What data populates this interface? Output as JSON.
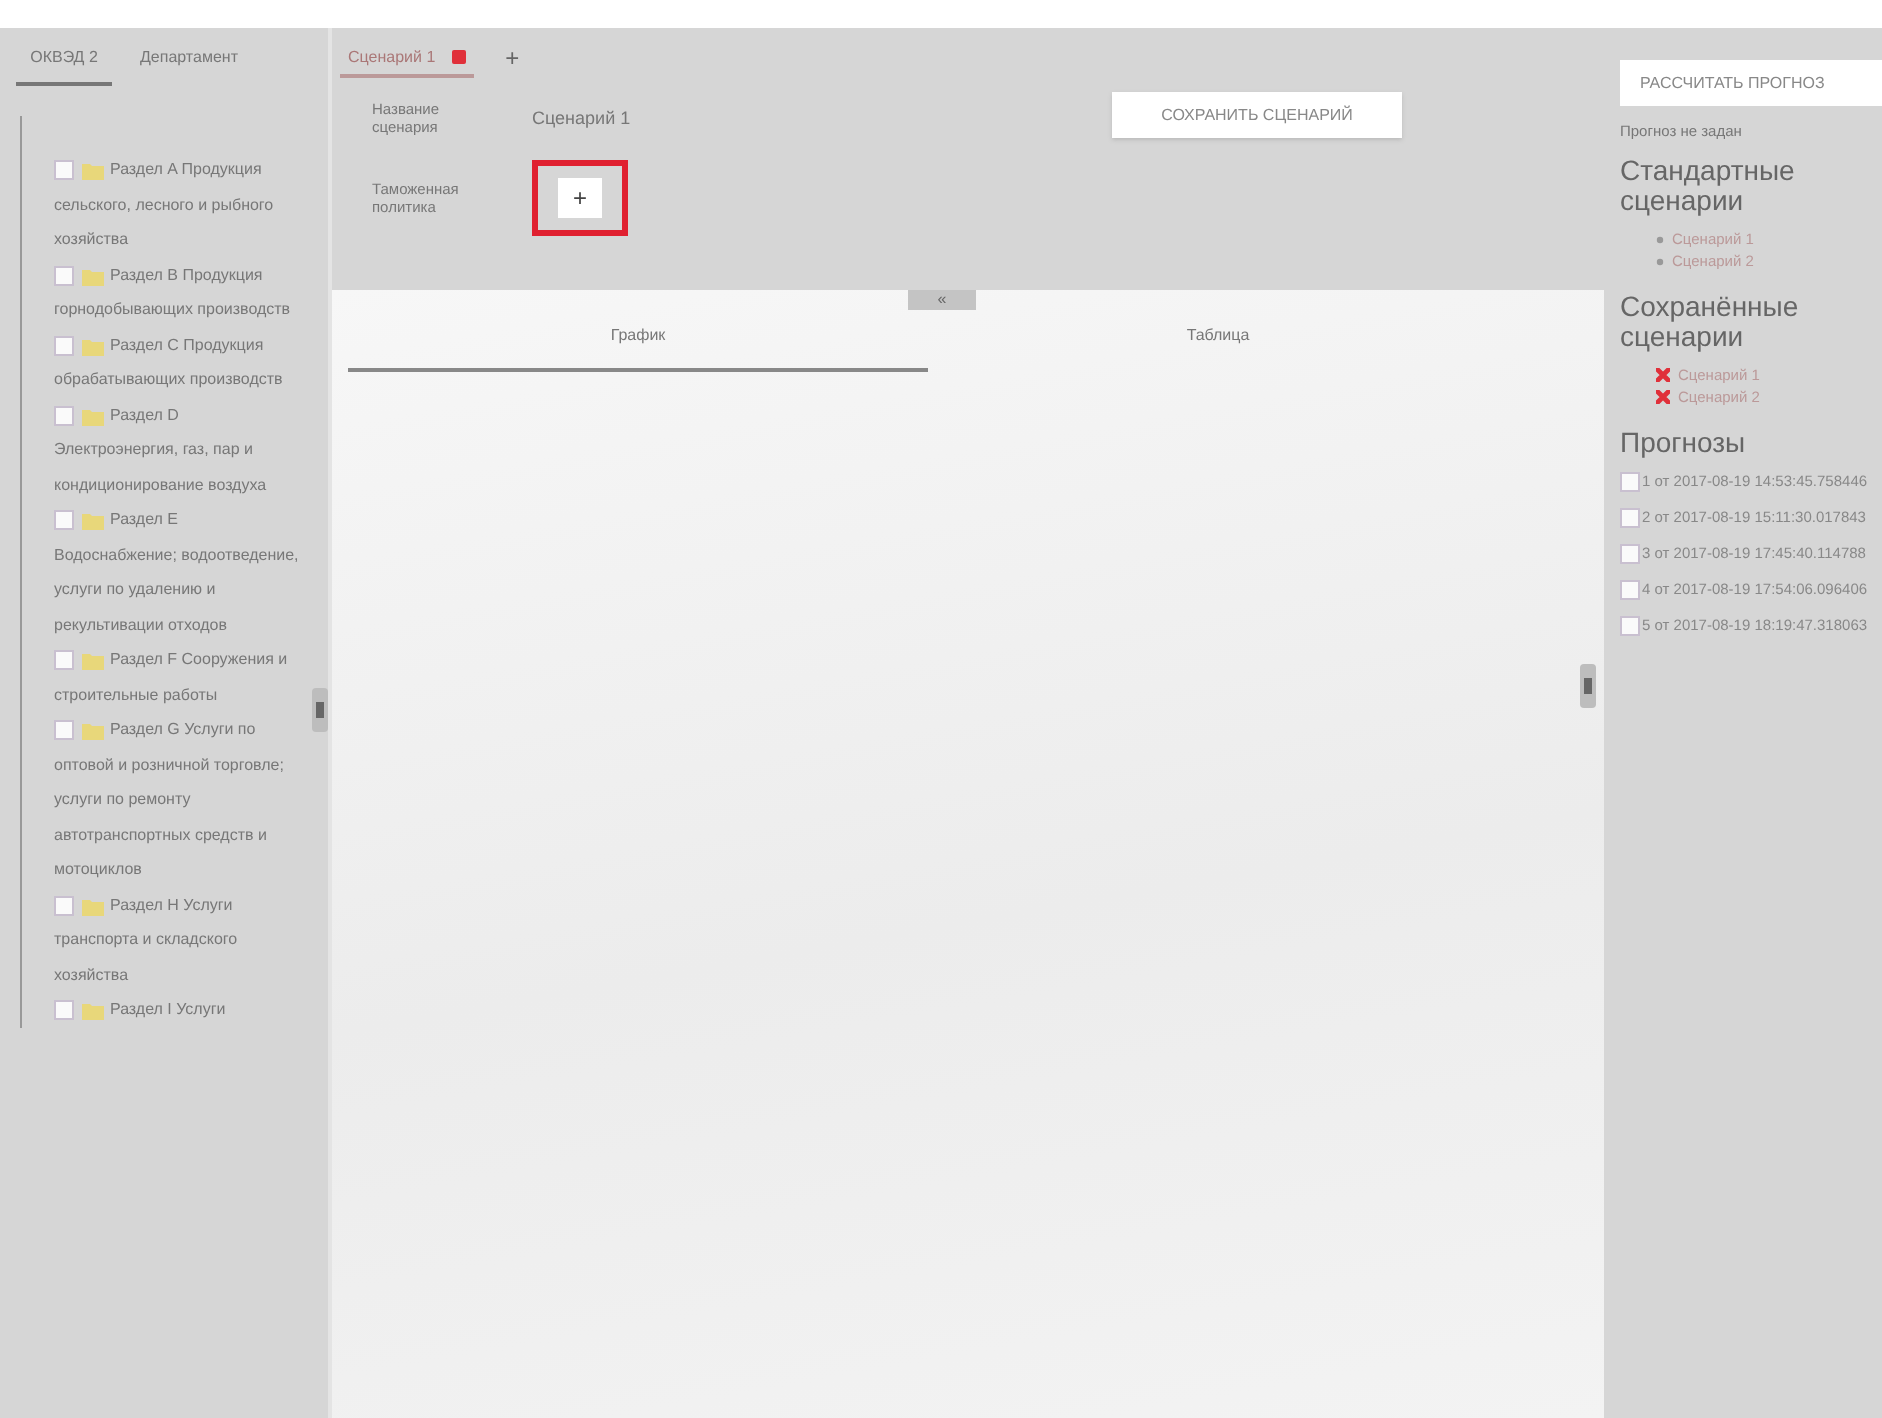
{
  "left_tabs": [
    {
      "label": "ОКВЭД 2",
      "selected": true
    },
    {
      "label": "Департамент",
      "selected": false
    }
  ],
  "tree": [
    {
      "label": "Раздел A Продукция сельского, лесного и рыбного хозяйства",
      "checked": false
    },
    {
      "label": "Раздел B Продукция горнодобывающих производств",
      "checked": false
    },
    {
      "label": "Раздел C Продукция обрабатывающих производств",
      "checked": false
    },
    {
      "label": "Раздел D Электроэнергия, газ, пар и кондиционирование воздуха",
      "checked": false
    },
    {
      "label": "Раздел E Водоснабжение; водоотведение, услуги по удалению и рекультивации отходов",
      "checked": false
    },
    {
      "label": "Раздел F Сооружения и строительные работы",
      "checked": false
    },
    {
      "label": "Раздел G Услуги по оптовой и розничной торговле; услуги по ремонту автотранспортных средств и мотоциклов",
      "checked": false
    },
    {
      "label": "Раздел H Услуги транспорта и складского хозяйства",
      "checked": false
    },
    {
      "label": "Раздел I Услуги",
      "checked": false
    }
  ],
  "scenario_tabs": [
    {
      "label": "Сценарий 1",
      "selected": true,
      "closable": true
    }
  ],
  "add_tab": "+",
  "form": {
    "name_label": "Название сценария",
    "name_value": "Сценарий 1",
    "policy_label": "Таможенная политика",
    "policy_button": "+",
    "highlighted": true
  },
  "save_button": "СОХРАНИТЬ СЦЕНАРИЙ",
  "collapse_button": "«",
  "view_tabs": [
    {
      "label": "График",
      "selected": true
    },
    {
      "label": "Таблица",
      "selected": false
    }
  ],
  "right": {
    "calc_button": "РАССЧИТАТЬ ПРОГНОЗ",
    "status": "Прогноз не задан",
    "standard_title": "Стандартные сценарии",
    "standard": [
      "Сценарий 1",
      "Сценарий 2"
    ],
    "saved_title": "Сохранённые сценарии",
    "saved": [
      "Сценарий 1",
      "Сценарий 2"
    ],
    "forecasts_title": "Прогнозы",
    "forecasts": [
      {
        "label": "1 от 2017-08-19 14:53:45.758446",
        "checked": false
      },
      {
        "label": "2 от 2017-08-19 15:11:30.017843",
        "checked": false
      },
      {
        "label": "3 от 2017-08-19 17:45:40.114788",
        "checked": false
      },
      {
        "label": "4 от 2017-08-19 17:54:06.096406",
        "checked": false
      },
      {
        "label": "5 от 2017-08-19 18:19:47.318063",
        "checked": false
      }
    ]
  }
}
